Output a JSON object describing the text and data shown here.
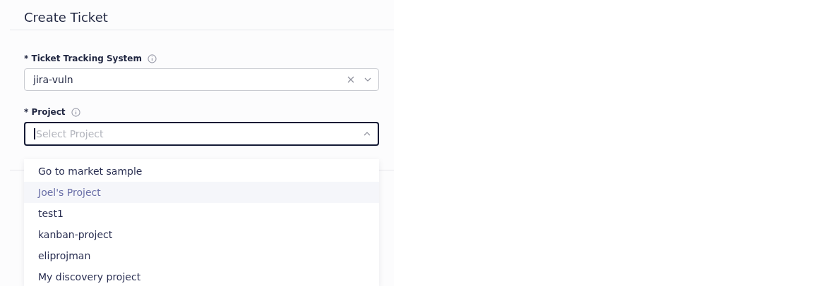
{
  "title": "Create Ticket",
  "fields": [
    {
      "label": "* Ticket Tracking System",
      "value": "jira-vuln",
      "clearable": true,
      "focused": false,
      "open": false
    },
    {
      "label": "* Project",
      "placeholder": "Select Project",
      "clearable": false,
      "focused": true,
      "open": true
    }
  ],
  "dropdown": [
    {
      "label": "Go to market sample",
      "highlighted": false
    },
    {
      "label": "Joel's Project",
      "highlighted": true
    },
    {
      "label": "test1",
      "highlighted": false
    },
    {
      "label": "kanban-project",
      "highlighted": false
    },
    {
      "label": "eliprojman",
      "highlighted": false
    },
    {
      "label": "My discovery project",
      "highlighted": false
    }
  ]
}
